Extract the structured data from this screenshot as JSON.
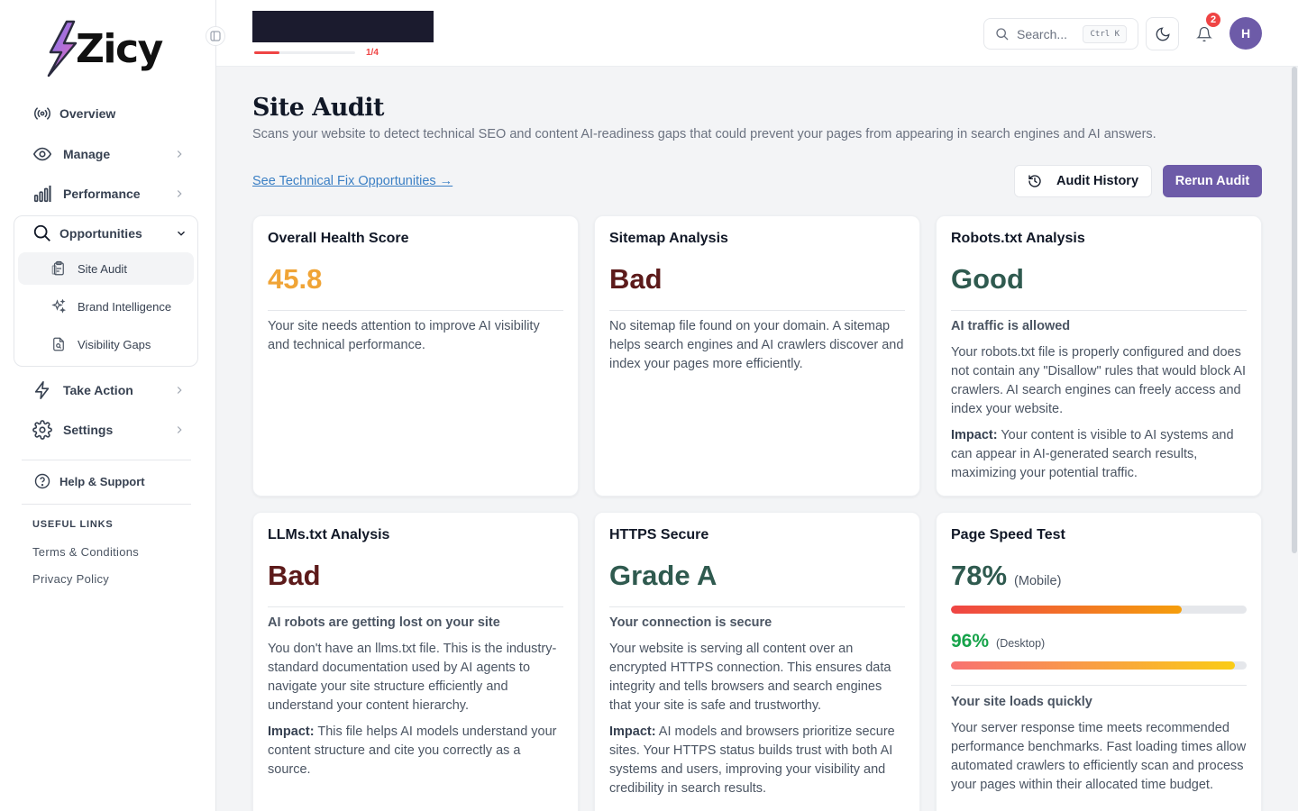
{
  "brand": {
    "name": "Zicy",
    "accent": "#6d5ba8"
  },
  "sidebar": {
    "nav": [
      {
        "label": "Overview",
        "icon": "broadcast-icon"
      },
      {
        "label": "Manage",
        "icon": "eye-icon"
      },
      {
        "label": "Performance",
        "icon": "bar-chart-icon"
      },
      {
        "label": "Opportunities",
        "icon": "search-icon"
      },
      {
        "label": "Take Action",
        "icon": "lightning-icon"
      },
      {
        "label": "Settings",
        "icon": "gear-icon"
      }
    ],
    "sub": [
      {
        "label": "Site Audit",
        "icon": "clipboard-icon"
      },
      {
        "label": "Brand Intelligence",
        "icon": "sparkles-icon"
      },
      {
        "label": "Visibility Gaps",
        "icon": "file-search-icon"
      }
    ],
    "help": "Help & Support",
    "useful_links_title": "USEFUL LINKS",
    "links": [
      "Terms & Conditions",
      "Privacy Policy"
    ]
  },
  "topbar": {
    "progress_label": "1/4",
    "progress_value": 0.25,
    "search_placeholder": "Search...",
    "search_shortcut": "Ctrl K",
    "notification_count": "2",
    "avatar_initial": "H"
  },
  "page": {
    "title": "Site Audit",
    "subtitle": "Scans your website to detect technical SEO and content AI-readiness gaps that could prevent your pages from appearing in search engines and AI answers.",
    "fix_link": "See Technical Fix Opportunities →",
    "history_button": "Audit History",
    "rerun_button": "Rerun Audit"
  },
  "cards": {
    "health": {
      "title": "Overall Health Score",
      "value": "45.8",
      "text": "Your site needs attention to improve AI visibility and technical performance."
    },
    "sitemap": {
      "title": "Sitemap Analysis",
      "status": "Bad",
      "text": "No sitemap file found on your domain. A sitemap helps search engines and AI crawlers discover and index your pages more efficiently."
    },
    "robots": {
      "title": "Robots.txt Analysis",
      "status": "Good",
      "subhead": "AI traffic is allowed",
      "text": "Your robots.txt file is properly configured and does not contain any \"Disallow\" rules that would block AI crawlers. AI search engines can freely access and index your website.",
      "impact_label": "Impact:",
      "impact": " Your content is visible to AI systems and can appear in AI-generated search results, maximizing your potential traffic."
    },
    "llms": {
      "title": "LLMs.txt Analysis",
      "status": "Bad",
      "subhead": "AI robots are getting lost on your site",
      "text": "You don't have an llms.txt file. This is the industry-standard documentation used by AI agents to navigate your site structure efficiently and understand your content hierarchy.",
      "impact_label": "Impact:",
      "impact": " This file helps AI models understand your content structure and cite you correctly as a source."
    },
    "https": {
      "title": "HTTPS Secure",
      "status": "Grade A",
      "subhead": "Your connection is secure",
      "text": "Your website is serving all content over an encrypted HTTPS connection. This ensures data integrity and tells browsers and search engines that your site is safe and trustworthy.",
      "impact_label": "Impact:",
      "impact": " AI models and browsers prioritize secure sites. Your HTTPS status builds trust with both AI systems and users, improving your visibility and credibility in search results."
    },
    "speed": {
      "title": "Page Speed Test",
      "mobile_value": "78%",
      "mobile_label": "(Mobile)",
      "mobile_score": 78,
      "desktop_value": "96%",
      "desktop_label": "(Desktop)",
      "desktop_score": 96,
      "subhead": "Your site loads quickly",
      "text": "Your server response time meets recommended performance benchmarks. Fast loading times allow automated crawlers to efficiently scan and process your pages within their allocated time budget."
    }
  },
  "colors": {
    "bad": "#5c1a1a",
    "good": "#2f5a4f",
    "warning": "#f0a436",
    "desktop_green": "#16a34a"
  }
}
